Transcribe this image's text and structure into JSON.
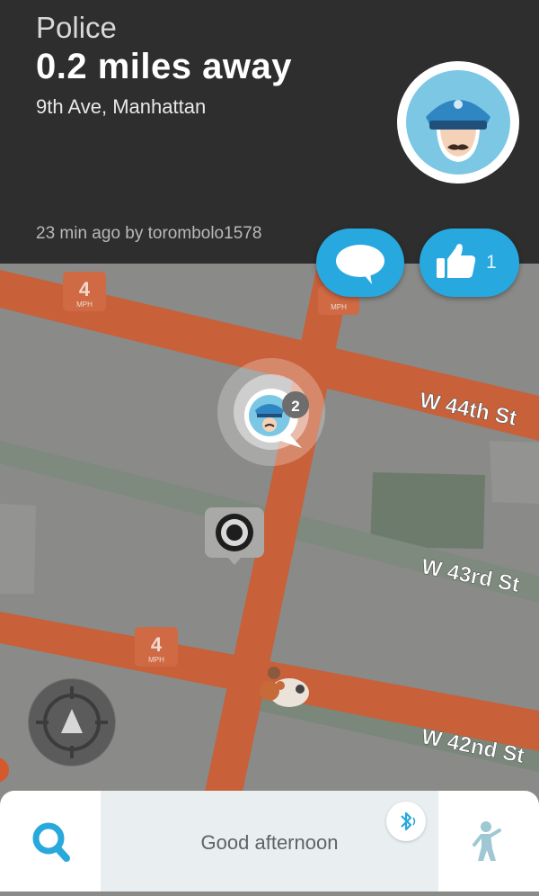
{
  "report": {
    "type": "Police",
    "distance": "0.2 miles away",
    "location": "9th Ave, Manhattan",
    "meta": "23 min ago by torombolo1578"
  },
  "actions": {
    "like_count": "1"
  },
  "map": {
    "streets": [
      "W 44th St",
      "W 43rd St",
      "W 42nd St"
    ],
    "speed_signs": [
      {
        "value": "4",
        "unit": "MPH"
      },
      {
        "value": "4",
        "unit": "MPH"
      },
      {
        "value": "",
        "unit": "MPH"
      }
    ],
    "police_marker_count": "2"
  },
  "bottom_bar": {
    "greeting": "Good afternoon"
  },
  "icons": [
    "police-avatar-icon",
    "comment-icon",
    "thumbs-up-icon",
    "compass-icon",
    "search-icon",
    "bluetooth-icon",
    "walking-person-icon",
    "starbucks-icon",
    "wazer-icon"
  ],
  "colors": {
    "header_bg": "#2e2e2e",
    "accent_blue": "#27a8de",
    "road_orange": "#c8603a",
    "map_bg": "#8a8a88"
  }
}
